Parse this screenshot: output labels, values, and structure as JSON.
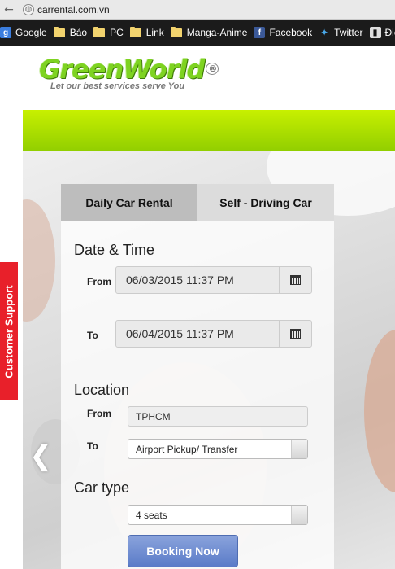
{
  "browser": {
    "url": "carrental.com.vn",
    "bookmarks": [
      {
        "label": "Google",
        "icon": "google-icon"
      },
      {
        "label": "Báo",
        "icon": "folder-icon"
      },
      {
        "label": "PC",
        "icon": "folder-icon"
      },
      {
        "label": "Link",
        "icon": "folder-icon"
      },
      {
        "label": "Manga-Anime",
        "icon": "folder-icon"
      },
      {
        "label": "Facebook",
        "icon": "facebook-icon"
      },
      {
        "label": "Twitter",
        "icon": "twitter-icon"
      },
      {
        "label": "Điể",
        "icon": "bookmark-icon"
      }
    ]
  },
  "brand": {
    "name_part1": "Green",
    "name_part2": "World",
    "reg": "®",
    "tagline": "Let our best services serve You",
    "accent": "#8fd400"
  },
  "support_label": "Customer Support",
  "carousel": {
    "prev_glyph": "❮"
  },
  "booking": {
    "tabs": [
      "Daily Car Rental",
      "Self - Driving Car"
    ],
    "active_tab": 0,
    "datetime": {
      "heading": "Date & Time",
      "from_label": "From",
      "from_value": "06/03/2015 11:37 PM",
      "to_label": "To",
      "to_value": "06/04/2015 11:37 PM"
    },
    "location": {
      "heading": "Location",
      "from_label": "From",
      "from_value": "TPHCM",
      "to_label": "To",
      "to_value": "Airport Pickup/ Transfer"
    },
    "car": {
      "heading": "Car type",
      "value": "4 seats"
    },
    "submit_label": "Booking Now"
  }
}
